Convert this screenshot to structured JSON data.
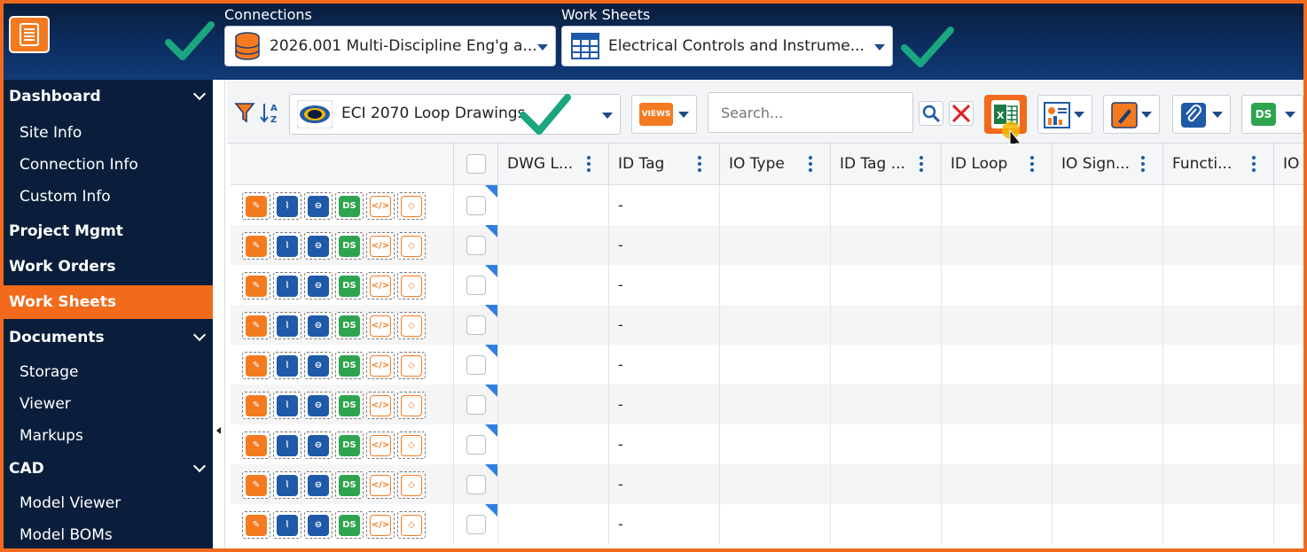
{
  "header": {
    "connections_label": "Connections",
    "connection_value": "2026.001 Multi-Discipline Eng'g a...",
    "worksheets_label": "Work Sheets",
    "worksheet_value": "Electrical Controls and Instrume..."
  },
  "sidebar": {
    "items": [
      {
        "label": "Dashboard",
        "type": "section",
        "expandable": true
      },
      {
        "label": "Site Info",
        "type": "sub"
      },
      {
        "label": "Connection Info",
        "type": "sub"
      },
      {
        "label": "Custom Info",
        "type": "sub"
      },
      {
        "label": "Project Mgmt",
        "type": "section"
      },
      {
        "label": "Work Orders",
        "type": "section"
      },
      {
        "label": "Work Sheets",
        "type": "section",
        "active": true
      },
      {
        "label": "Documents",
        "type": "section",
        "expandable": true
      },
      {
        "label": "Storage",
        "type": "sub"
      },
      {
        "label": "Viewer",
        "type": "sub"
      },
      {
        "label": "Markups",
        "type": "sub"
      },
      {
        "label": "CAD",
        "type": "section",
        "expandable": true
      },
      {
        "label": "Model Viewer",
        "type": "sub"
      },
      {
        "label": "Model BOMs",
        "type": "sub"
      }
    ]
  },
  "toolbar": {
    "view_value": "ECI 2070 Loop Drawings",
    "views_label": "VIEWS",
    "search_placeholder": "Search...",
    "ds_label": "DS"
  },
  "grid": {
    "columns": [
      "DWG L...",
      "ID Tag",
      "IO Type",
      "ID Tag ...",
      "ID Loop",
      "IO Sign...",
      "Functi...",
      "IO I"
    ],
    "row_actions": [
      "edit-icon",
      "attach-icon",
      "attach-remove-icon",
      "ds-icon",
      "code-icon",
      "tags-icon"
    ],
    "rows": [
      {
        "id_tag": "-"
      },
      {
        "id_tag": "-"
      },
      {
        "id_tag": "-"
      },
      {
        "id_tag": "-"
      },
      {
        "id_tag": "-"
      },
      {
        "id_tag": "-"
      },
      {
        "id_tag": "-"
      },
      {
        "id_tag": "-"
      },
      {
        "id_tag": "-"
      }
    ]
  },
  "colors": {
    "accent": "#f26a1b",
    "nav_bg": "#0a1e3c",
    "check_green": "#1aa67e",
    "blue": "#1e5aa8"
  }
}
